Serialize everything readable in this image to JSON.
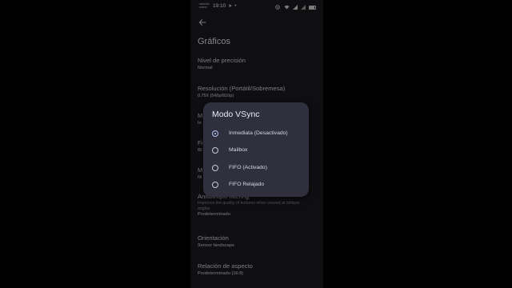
{
  "status_bar": {
    "carrier": "ssiocillo\nsosrsr",
    "time": "19:10",
    "battery_level_percent": 80
  },
  "page": {
    "title": "Gráficos"
  },
  "settings": [
    {
      "title": "Nivel de precisión",
      "value": "Normal"
    },
    {
      "title": "Resolución (Portátil/Sobremesa)",
      "value": "0.75X (540p/810p)"
    },
    {
      "title": "M",
      "value": "In"
    },
    {
      "title": "Fi",
      "value": "Bi"
    },
    {
      "title": "M",
      "value": "Ni"
    },
    {
      "title": "Anisotropic filtering",
      "description": "Improves the quality of textures when viewed at oblique angles",
      "value": "Predeterminado"
    },
    {
      "title": "Orientación",
      "value": "Sensor landscape"
    },
    {
      "title": "Relación de aspecto",
      "value": "Predeterminado (16:9)"
    }
  ],
  "dialog": {
    "title": "Modo VSync",
    "selected_index": 0,
    "options": [
      {
        "label": "Inmediata (Desactivado)"
      },
      {
        "label": "Mailbox"
      },
      {
        "label": "FIFO (Activado)"
      },
      {
        "label": "FIFO Relajado"
      }
    ]
  },
  "colors": {
    "screen_background": "#1b1b1f",
    "dialog_background": "#2f2f3d",
    "radio_accent": "#b9c4f5"
  }
}
